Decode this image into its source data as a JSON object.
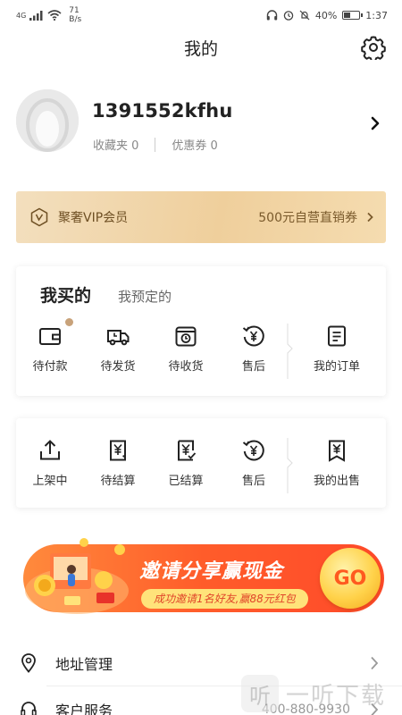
{
  "status_bar": {
    "network": "4G",
    "net_speed_value": "71",
    "net_speed_unit": "B/s",
    "battery_text": "40%",
    "battery_level": 0.4,
    "time": "1:37"
  },
  "header": {
    "title": "我的"
  },
  "profile": {
    "username": "1391552kfhu",
    "favorites_label": "收藏夹 0",
    "coupons_label": "优惠券 0"
  },
  "vip": {
    "label": "聚奢VIP会员",
    "promo": "500元自营直销券"
  },
  "purchases": {
    "tab_active": "我买的",
    "tab_inactive": "我预定的",
    "items": [
      {
        "label": "待付款",
        "icon": "wallet-icon"
      },
      {
        "label": "待发货",
        "icon": "truck-icon"
      },
      {
        "label": "待收货",
        "icon": "package-clock-icon"
      },
      {
        "label": "售后",
        "icon": "yuan-return-icon"
      },
      {
        "label": "我的订单",
        "icon": "order-list-icon"
      }
    ]
  },
  "sales": {
    "items": [
      {
        "label": "上架中",
        "icon": "upload-icon"
      },
      {
        "label": "待结算",
        "icon": "pending-settlement-icon"
      },
      {
        "label": "已结算",
        "icon": "settled-icon"
      },
      {
        "label": "售后",
        "icon": "yuan-return-icon"
      },
      {
        "label": "我的出售",
        "icon": "my-sales-icon"
      }
    ]
  },
  "banner": {
    "title": "邀请分享赢现金",
    "subtitle": "成功邀请1名好友,赢88元红包",
    "cta": "GO"
  },
  "list": {
    "address": "地址管理",
    "service": "客户服务",
    "service_phone": "400-880-9930"
  },
  "watermark": {
    "glyph": "听",
    "text": "一听下载"
  },
  "colors": {
    "vip_gold": "#efcf9c",
    "banner_orange": "#ff5c2a",
    "badge_dot": "#c8a27a"
  }
}
